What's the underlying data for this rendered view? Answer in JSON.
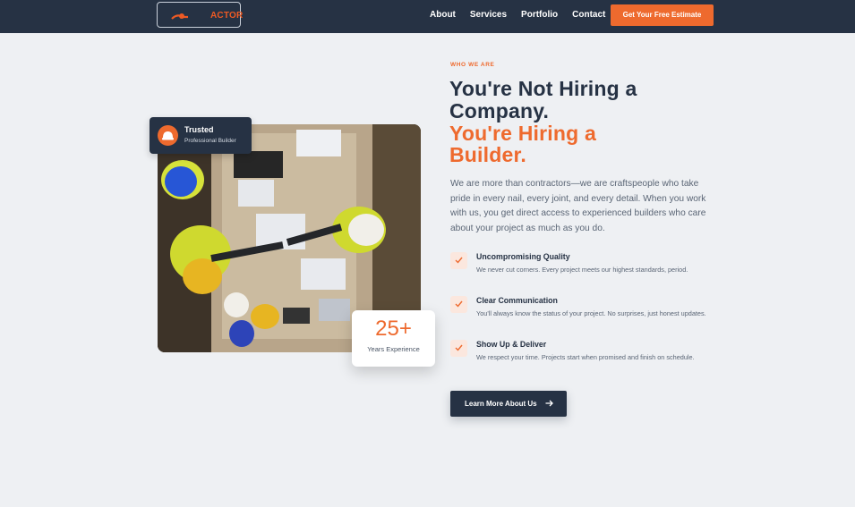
{
  "nav": {
    "logo_text": "ACTOR",
    "links": [
      "About",
      "Services",
      "Portfolio",
      "Contact"
    ],
    "cta_label": "Get Your Free Estimate"
  },
  "badge": {
    "title": "Trusted",
    "subtitle": "Professional Builder",
    "icon": "hard-hat-icon"
  },
  "experience": {
    "value": "25+",
    "label": "Years Experience"
  },
  "hero": {
    "eyebrow": "WHO WE ARE",
    "heading_line1": "You're Not Hiring a",
    "heading_line2": "Company.",
    "heading_line3": "You're Hiring a",
    "heading_line4": "Builder.",
    "intro": "We are more than contractors—we are craftspeople who take pride in every nail, every joint, and every detail. When you work with us, you get direct access to experienced builders who care about your project as much as you do."
  },
  "features": [
    {
      "title": "Uncompromising Quality",
      "description": "We never cut corners. Every project meets our highest standards, period."
    },
    {
      "title": "Clear Communication",
      "description": "You'll always know the status of your project. No surprises, just honest updates."
    },
    {
      "title": "Show Up & Deliver",
      "description": "We respect your time. Projects start when promised and finish on schedule."
    }
  ],
  "learn_more": {
    "label": "Learn More About Us",
    "icon": "arrow-right-icon"
  },
  "colors": {
    "navy": "#263244",
    "orange": "#ee6a2e",
    "background": "#eef0f3"
  }
}
